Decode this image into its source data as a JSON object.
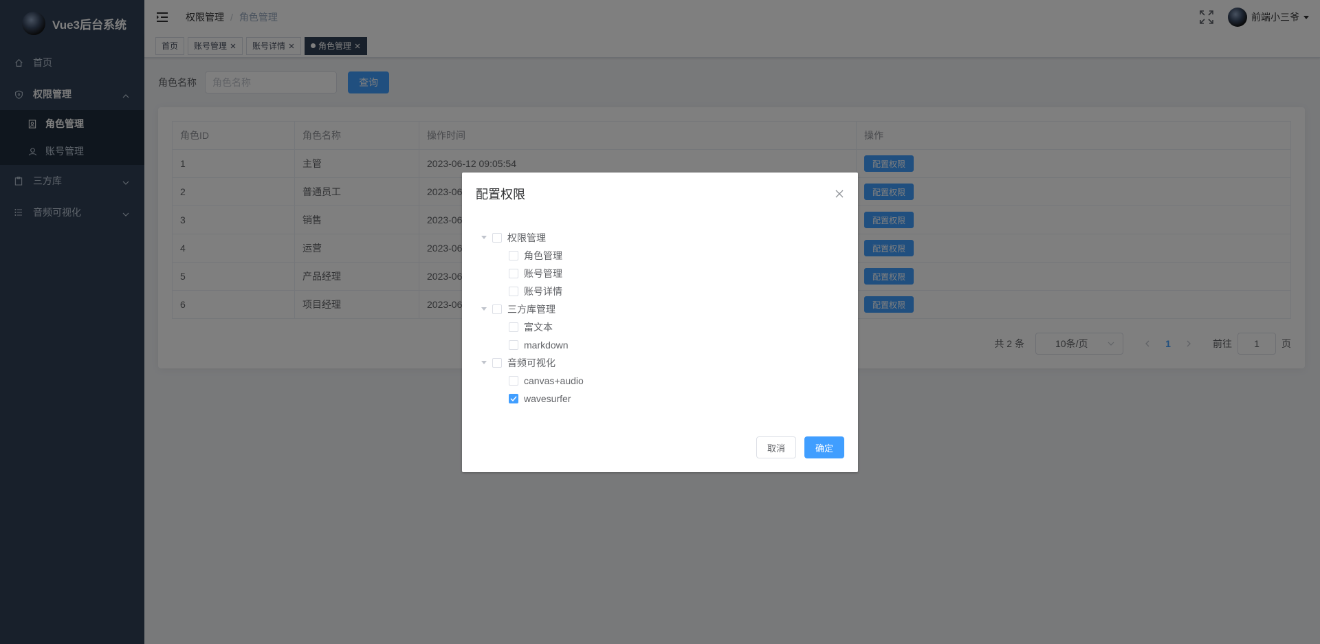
{
  "app": {
    "title": "Vue3后台系统"
  },
  "sidebar": {
    "items": [
      {
        "label": "首页",
        "icon": "home-icon"
      },
      {
        "label": "权限管理",
        "icon": "shield-icon",
        "expanded": true,
        "children": [
          {
            "label": "角色管理",
            "icon": "role-icon",
            "active": true
          },
          {
            "label": "账号管理",
            "icon": "user-icon"
          }
        ]
      },
      {
        "label": "三方库",
        "icon": "library-icon"
      },
      {
        "label": "音频可视化",
        "icon": "list-icon"
      }
    ]
  },
  "header": {
    "breadcrumb": [
      "权限管理",
      "角色管理"
    ],
    "breadcrumb_sep": "/",
    "user_name": "前端小三爷"
  },
  "tags": [
    {
      "label": "首页",
      "closable": false,
      "active": false
    },
    {
      "label": "账号管理",
      "closable": true,
      "active": false
    },
    {
      "label": "账号详情",
      "closable": true,
      "active": false
    },
    {
      "label": "角色管理",
      "closable": true,
      "active": true
    }
  ],
  "search": {
    "label": "角色名称",
    "placeholder": "角色名称",
    "button": "查询"
  },
  "table": {
    "columns": [
      "角色ID",
      "角色名称",
      "操作时间",
      "操作"
    ],
    "rows": [
      {
        "id": "1",
        "name": "主管",
        "time": "2023-06-12 09:05:54",
        "action": "配置权限"
      },
      {
        "id": "2",
        "name": "普通员工",
        "time": "2023-06",
        "action": "配置权限"
      },
      {
        "id": "3",
        "name": "销售",
        "time": "2023-06",
        "action": "配置权限"
      },
      {
        "id": "4",
        "name": "运营",
        "time": "2023-06",
        "action": "配置权限"
      },
      {
        "id": "5",
        "name": "产品经理",
        "time": "2023-06",
        "action": "配置权限"
      },
      {
        "id": "6",
        "name": "项目经理",
        "time": "2023-06",
        "action": "配置权限"
      }
    ]
  },
  "pagination": {
    "total": "共 2 条",
    "page_size": "10条/页",
    "current": "1",
    "goto_label": "前往",
    "goto_value": "1",
    "page_suffix": "页"
  },
  "dialog": {
    "title": "配置权限",
    "tree": [
      {
        "label": "权限管理",
        "checked": false,
        "children": [
          {
            "label": "角色管理",
            "checked": false
          },
          {
            "label": "账号管理",
            "checked": false
          },
          {
            "label": "账号详情",
            "checked": false
          }
        ]
      },
      {
        "label": "三方库管理",
        "checked": false,
        "children": [
          {
            "label": "富文本",
            "checked": false
          },
          {
            "label": "markdown",
            "checked": false
          }
        ]
      },
      {
        "label": "音频可视化",
        "checked": false,
        "children": [
          {
            "label": "canvas+audio",
            "checked": false
          },
          {
            "label": "wavesurfer",
            "checked": true
          }
        ]
      }
    ],
    "cancel": "取消",
    "confirm": "确定"
  },
  "colors": {
    "sidebar_bg": "#304156",
    "submenu_bg": "#1f2d3d",
    "primary": "#409eff",
    "mask": "rgba(0,0,0,0.5)"
  }
}
